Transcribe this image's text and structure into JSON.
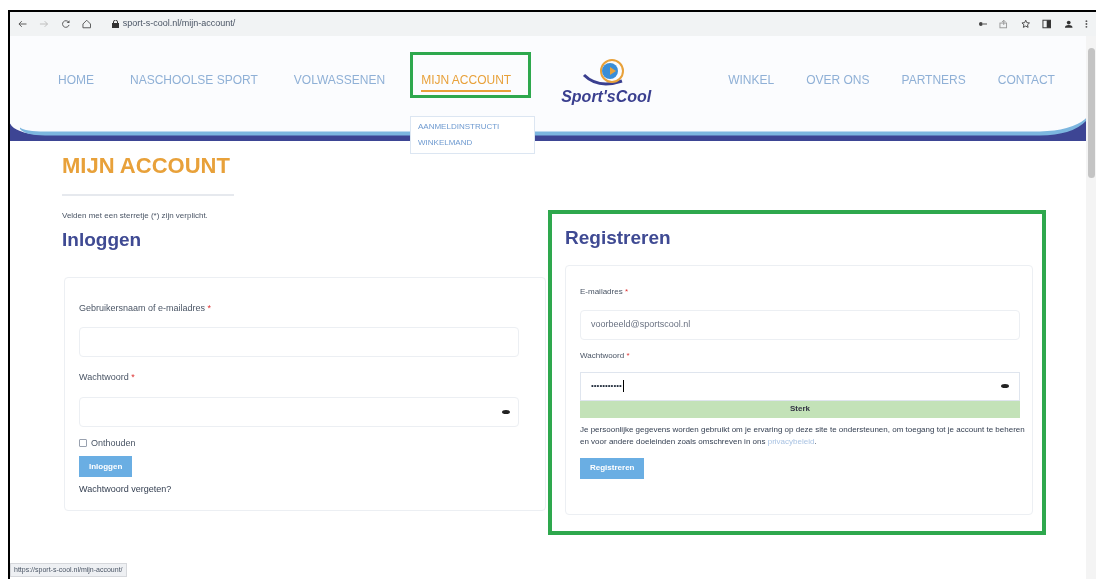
{
  "browser": {
    "url": "sport-s-cool.nl/mijn-account/"
  },
  "nav": {
    "items": [
      {
        "label": "HOME",
        "selected": false
      },
      {
        "label": "NASCHOOLSE SPORT",
        "selected": false
      },
      {
        "label": "VOLWASSENEN",
        "selected": false
      },
      {
        "label": "MIJN ACCOUNT",
        "selected": true
      }
    ],
    "logo": "Sport'sCool",
    "items_right": [
      {
        "label": "WINKEL",
        "selected": false
      },
      {
        "label": "OVER ONS",
        "selected": false
      },
      {
        "label": "PARTNERS",
        "selected": false
      },
      {
        "label": "CONTACT",
        "selected": false
      }
    ],
    "dropdown": [
      "AANMELDINSTRUCTI",
      "WINKELMAND"
    ]
  },
  "page_title": "MIJN ACCOUNT",
  "required_note": "Velden met een sterretje (*) zijn verplicht.",
  "login": {
    "heading": "Inloggen",
    "username_label": "Gebruikersnaam of e-mailadres",
    "password_label": "Wachtwoord",
    "required_mark": "*",
    "remember": {
      "label": "Onthouden",
      "checked": false
    },
    "button": "Inloggen",
    "forgot_link": "Wachtwoord vergeten?"
  },
  "register": {
    "heading": "Registreren",
    "email_label": "E-mailadres",
    "email_value": "voorbeeld@sportscool.nl",
    "password_label": "Wachtwoord",
    "required_mark": "*",
    "password_value": "•••••••••••",
    "strength": "Sterk",
    "privacy_text": "Je persoonlijke gegevens worden gebruikt om je ervaring op deze site te ondersteunen, om toegang tot je account te beheren en voor andere doeleinden zoals omschreven in ons",
    "privacy_link": "privacybeleid",
    "privacy_end": ".",
    "button": "Registreren"
  },
  "status_bar": "https://sport-s-cool.nl/mijn-account/"
}
